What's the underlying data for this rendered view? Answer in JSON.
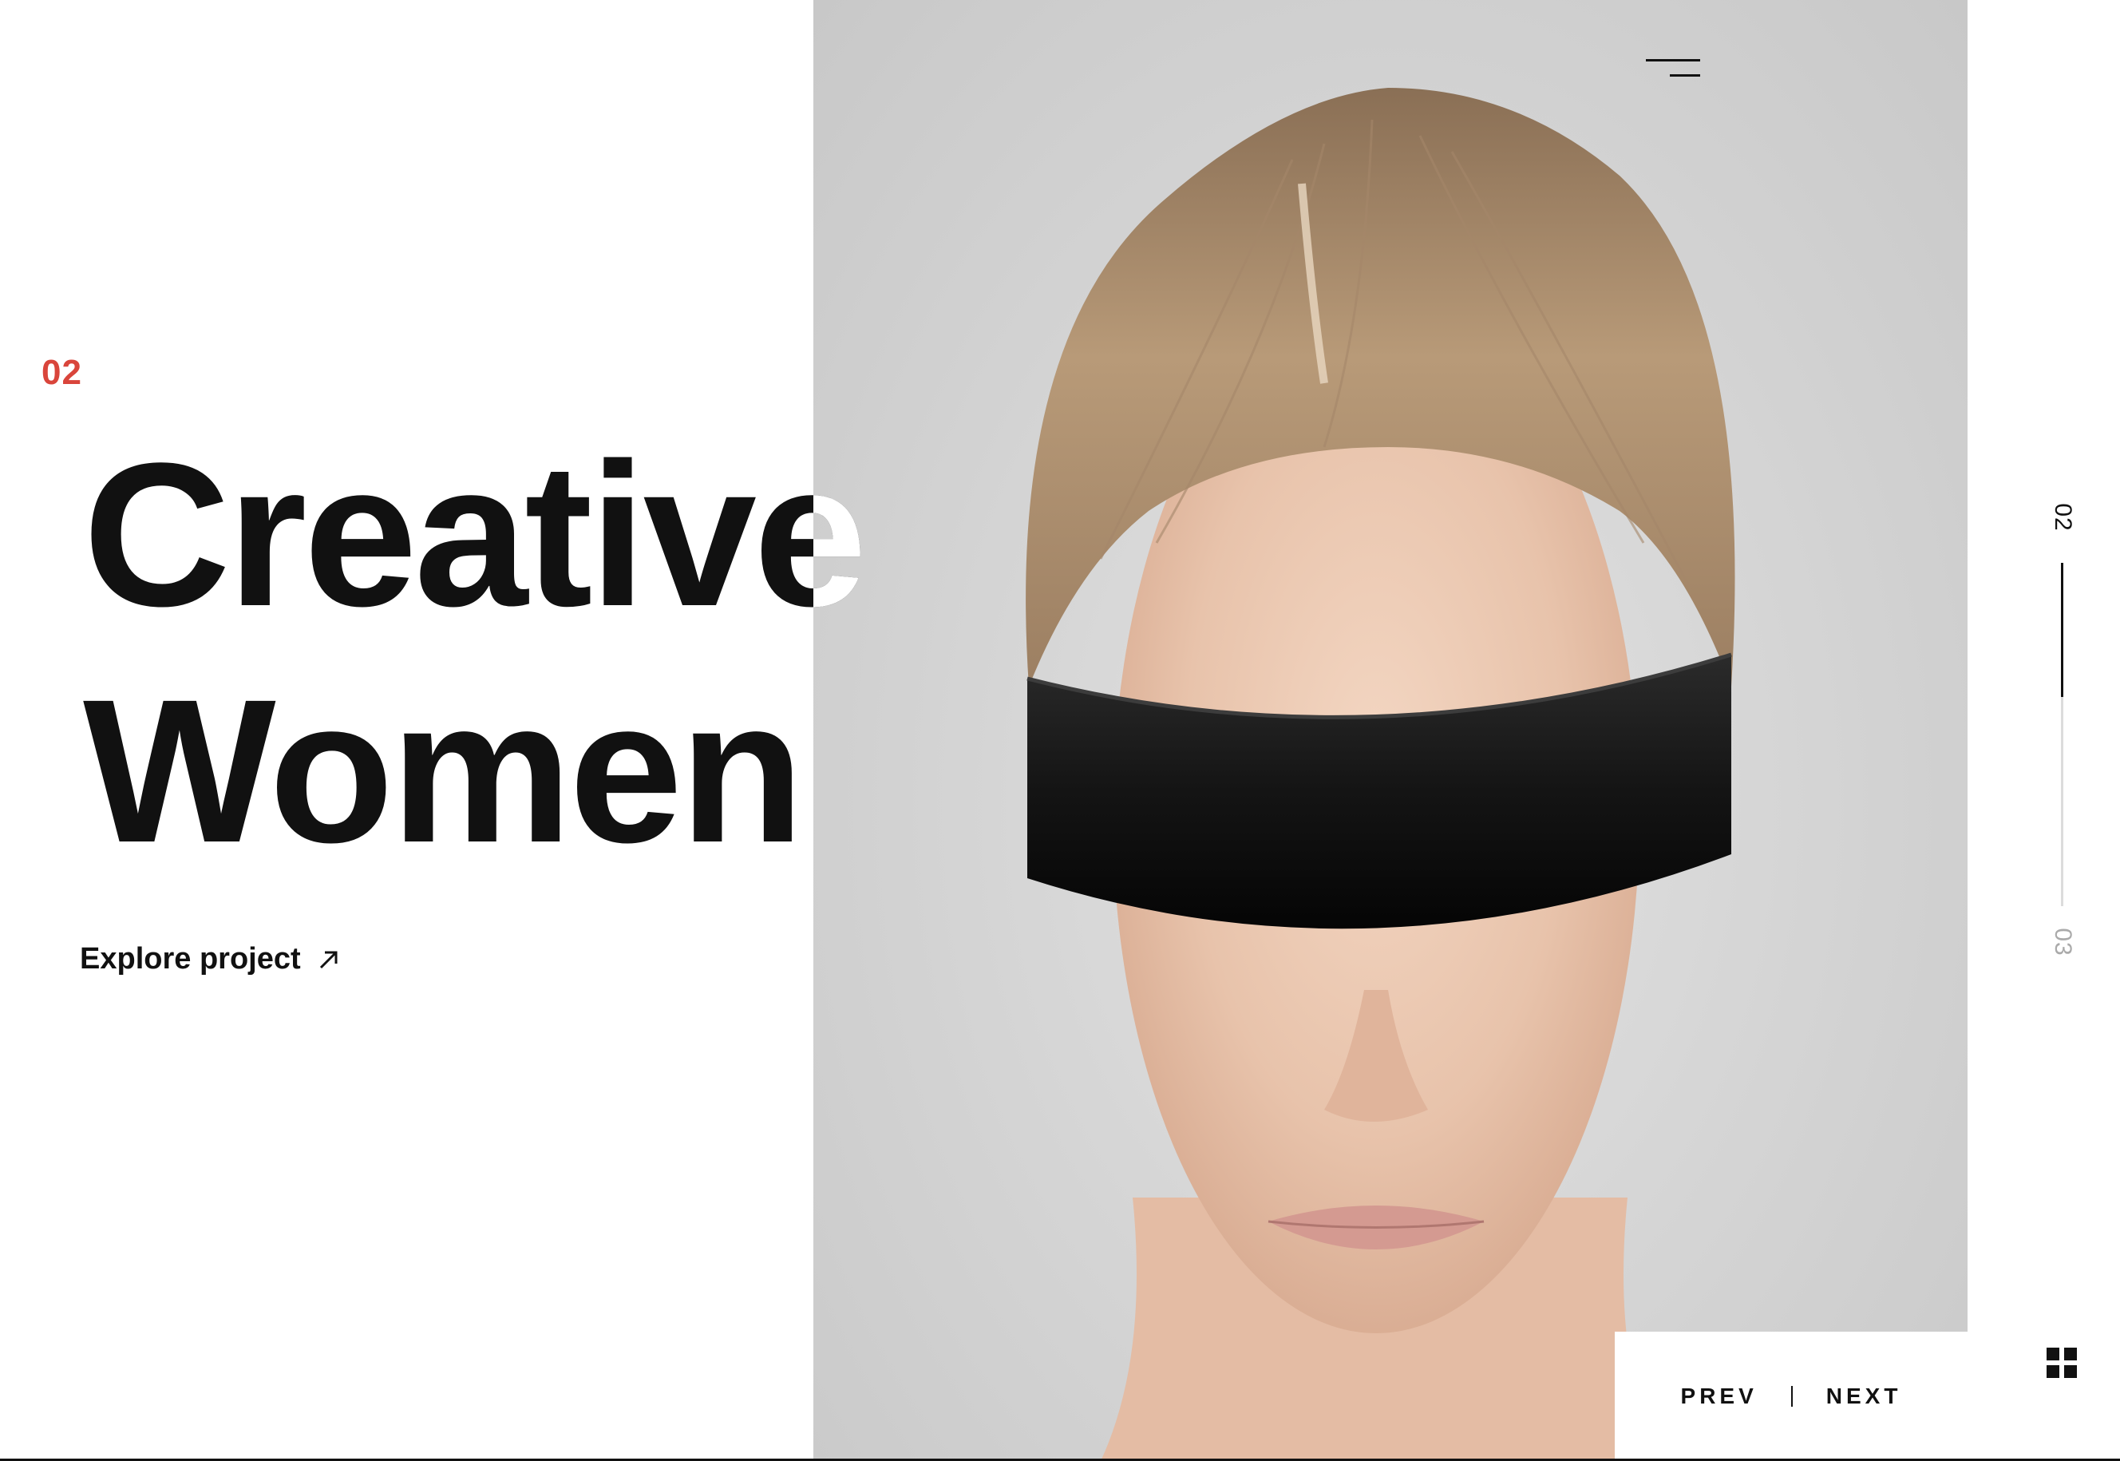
{
  "slide": {
    "index": "02",
    "title_line1": "Creative",
    "title_line2": "Women"
  },
  "explore": {
    "label": "Explore project"
  },
  "progress": {
    "current": "02",
    "next": "03",
    "fill_fraction": 0.39
  },
  "pager": {
    "prev": "PREV",
    "next": "NEXT"
  },
  "colors": {
    "accent": "#d9453b",
    "ink": "#111111",
    "panel": "#d6d6d6"
  },
  "icons": {
    "menu": "hamburger-menu-icon",
    "arrow": "arrow-up-right-icon",
    "grid": "grid-view-icon"
  }
}
